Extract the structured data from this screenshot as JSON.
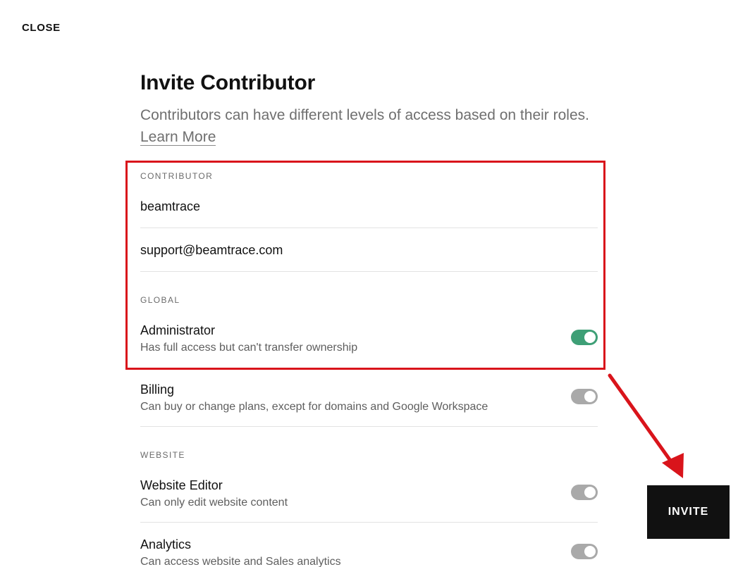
{
  "close_label": "CLOSE",
  "title": "Invite Contributor",
  "subtitle_text": "Contributors can have different levels of access based on their roles.",
  "learn_more_label": "Learn More",
  "contributor_section": {
    "label": "CONTRIBUTOR",
    "name_value": "beamtrace",
    "email_value": "support@beamtrace.com"
  },
  "global_section": {
    "label": "GLOBAL",
    "permissions": [
      {
        "title": "Administrator",
        "description": "Has full access but can't transfer ownership",
        "enabled": true
      },
      {
        "title": "Billing",
        "description": "Can buy or change plans, except for domains and Google Workspace",
        "enabled": false
      }
    ]
  },
  "website_section": {
    "label": "WEBSITE",
    "permissions": [
      {
        "title": "Website Editor",
        "description": "Can only edit website content",
        "enabled": false
      },
      {
        "title": "Analytics",
        "description": "Can access website and Sales analytics",
        "enabled": false
      }
    ]
  },
  "invite_label": "INVITE",
  "colors": {
    "toggle_on": "#3e9f76",
    "toggle_off": "#a9a9a9",
    "annotation_red": "#d9141b",
    "invite_bg": "#111111"
  }
}
